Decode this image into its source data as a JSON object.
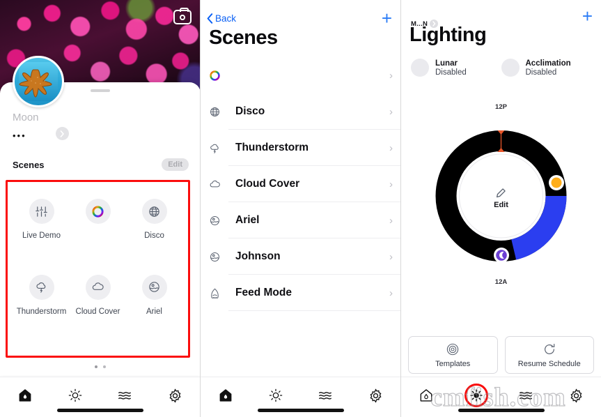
{
  "panel1": {
    "camera_icon": "camera-icon",
    "device_name": "Moon",
    "overflow": "•••",
    "chevron_icon": "chevron-right-icon",
    "scenes_title": "Scenes",
    "edit_label": "Edit",
    "highlight_color": "#fb0d0d",
    "scene_tiles": [
      {
        "label": "Live Demo",
        "icon": "sliders-icon"
      },
      {
        "label": "",
        "icon": "color-wheel-icon"
      },
      {
        "label": "Disco",
        "icon": "globe-icon"
      },
      {
        "label": "Thunderstorm",
        "icon": "storm-cloud-icon"
      },
      {
        "label": "Cloud Cover",
        "icon": "cloud-icon"
      },
      {
        "label": "Ariel",
        "icon": "sunset-water-icon"
      }
    ],
    "page_dots": 2,
    "tabs": [
      {
        "name": "home",
        "icon": "home-icon",
        "active": true
      },
      {
        "name": "lighting",
        "icon": "sun-icon",
        "active": false
      },
      {
        "name": "flow",
        "icon": "waves-icon",
        "active": false
      },
      {
        "name": "settings",
        "icon": "gear-icon",
        "active": false
      }
    ]
  },
  "panel2": {
    "back_label": "Back",
    "back_icon": "chevron-left-icon",
    "add_icon": "plus-icon",
    "title": "Scenes",
    "rows": [
      {
        "label": "",
        "icon": "color-wheel-icon"
      },
      {
        "label": "Disco",
        "icon": "globe-icon"
      },
      {
        "label": "Thunderstorm",
        "icon": "storm-cloud-icon"
      },
      {
        "label": "Cloud Cover",
        "icon": "cloud-icon"
      },
      {
        "label": "Ariel",
        "icon": "sunset-water-icon"
      },
      {
        "label": "Johnson",
        "icon": "sunset-water-icon"
      },
      {
        "label": "Feed Mode",
        "icon": "shark-icon"
      }
    ],
    "chevron": "›",
    "tabs": [
      {
        "name": "home",
        "icon": "home-icon",
        "active": true
      },
      {
        "name": "lighting",
        "icon": "sun-icon",
        "active": false
      },
      {
        "name": "flow",
        "icon": "waves-icon",
        "active": false
      },
      {
        "name": "settings",
        "icon": "gear-icon",
        "active": false
      }
    ]
  },
  "panel3": {
    "breadcrumb": "M...N",
    "breadcrumb_icon": "chevron-right-icon",
    "add_icon": "plus-icon",
    "title": "Lighting",
    "toggles": [
      {
        "name": "Lunar",
        "state": "Disabled"
      },
      {
        "name": "Acclimation",
        "state": "Disabled"
      }
    ],
    "dial": {
      "top_label": "12P",
      "bottom_label": "12A",
      "center_label": "Edit",
      "center_icon": "pencil-icon",
      "track_color": "#000000",
      "day_color": "#2b3ef0",
      "marker_color": "#e8562a",
      "sun_handle_color": "#ffae1a",
      "moon_handle_color": "#6b3fd4",
      "sunrise_angle_deg": 92,
      "sunset_angle_deg": 168
    },
    "buttons": [
      {
        "label": "Templates",
        "icon": "target-icon"
      },
      {
        "label": "Resume Schedule",
        "icon": "refresh-icon"
      }
    ],
    "tabs": [
      {
        "name": "home",
        "icon": "home-icon",
        "active": false
      },
      {
        "name": "lighting",
        "icon": "sun-icon",
        "active": true
      },
      {
        "name": "flow",
        "icon": "waves-icon",
        "active": false
      },
      {
        "name": "settings",
        "icon": "gear-icon",
        "active": false
      }
    ],
    "active_tab_ring_color": "#f90c0c"
  },
  "watermark": {
    "text": "cmfish.com"
  }
}
